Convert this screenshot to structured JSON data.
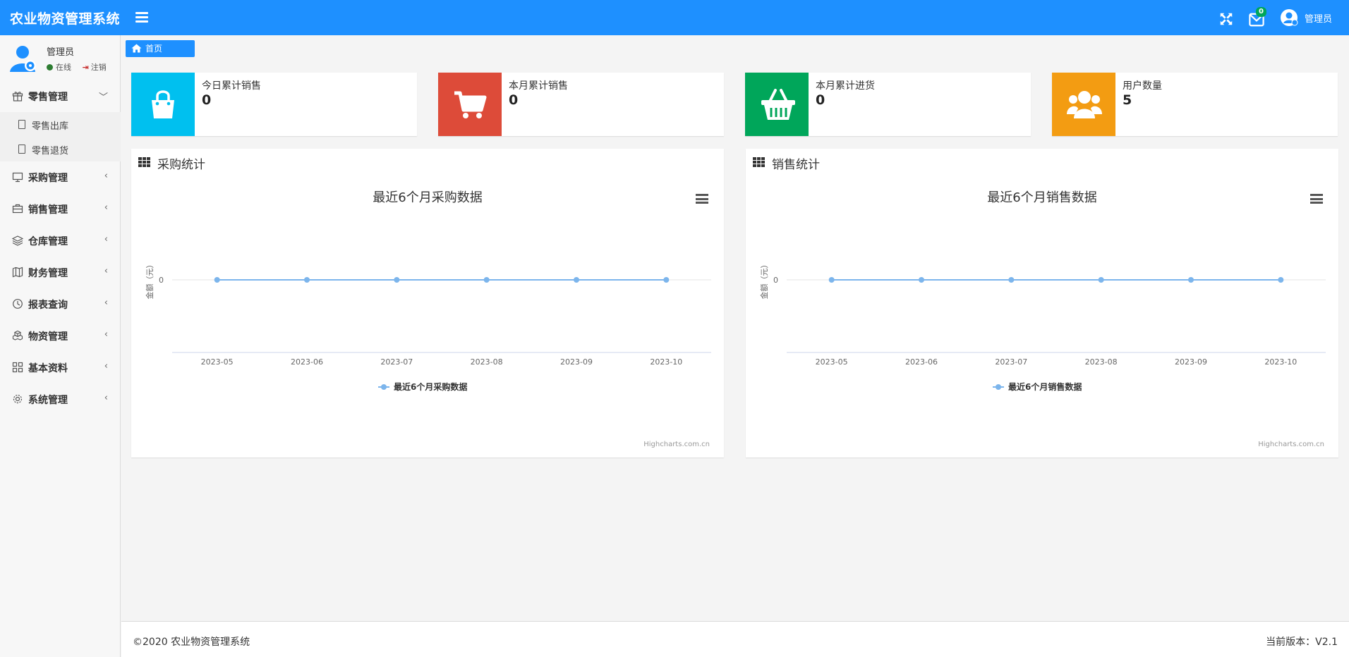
{
  "app": {
    "title": "农业物资管理系统"
  },
  "topbar": {
    "mail_badge": "0",
    "user_name": "管理员",
    "icons": [
      "menu-icon",
      "fullscreen-icon",
      "mail-icon",
      "user-avatar-icon"
    ]
  },
  "sidebar": {
    "user": {
      "name": "管理员",
      "status": "在线",
      "logout": "注销"
    },
    "items": [
      {
        "label": "零售管理",
        "icon": "gift-icon",
        "expanded": true,
        "children": [
          {
            "label": "零售出库"
          },
          {
            "label": "零售退货"
          }
        ]
      },
      {
        "label": "采购管理",
        "icon": "monitor-icon"
      },
      {
        "label": "销售管理",
        "icon": "briefcase-icon"
      },
      {
        "label": "仓库管理",
        "icon": "layers-icon"
      },
      {
        "label": "财务管理",
        "icon": "map-icon"
      },
      {
        "label": "报表查询",
        "icon": "history-icon"
      },
      {
        "label": "物资管理",
        "icon": "cubes-icon"
      },
      {
        "label": "基本资料",
        "icon": "grid-icon"
      },
      {
        "label": "系统管理",
        "icon": "gear-icon"
      }
    ]
  },
  "breadcrumb": {
    "home": "首页"
  },
  "info_boxes": [
    {
      "label": "今日累计销售",
      "value": "0",
      "color": "#00c0ef",
      "icon": "shopping-bag-icon"
    },
    {
      "label": "本月累计销售",
      "value": "0",
      "color": "#dd4b39",
      "icon": "cart-icon"
    },
    {
      "label": "本月累计进货",
      "value": "0",
      "color": "#00a65a",
      "icon": "basket-icon"
    },
    {
      "label": "用户数量",
      "value": "5",
      "color": "#f39c12",
      "icon": "users-icon"
    }
  ],
  "panels": [
    {
      "header": "采购统计"
    },
    {
      "header": "销售统计"
    }
  ],
  "chart_data": [
    {
      "type": "line",
      "title": "最近6个月采购数据",
      "ylabel": "金额（元）",
      "categories": [
        "2023-05",
        "2023-06",
        "2023-07",
        "2023-08",
        "2023-09",
        "2023-10"
      ],
      "series": [
        {
          "name": "最近6个月采购数据",
          "values": [
            0,
            0,
            0,
            0,
            0,
            0
          ]
        }
      ],
      "yticks": [
        "0"
      ],
      "legend": "bottom-center",
      "credits": "Highcharts.com.cn",
      "color": "#7cb5ec"
    },
    {
      "type": "line",
      "title": "最近6个月销售数据",
      "ylabel": "金额（元）",
      "categories": [
        "2023-05",
        "2023-06",
        "2023-07",
        "2023-08",
        "2023-09",
        "2023-10"
      ],
      "series": [
        {
          "name": "最近6个月销售数据",
          "values": [
            0,
            0,
            0,
            0,
            0,
            0
          ]
        }
      ],
      "yticks": [
        "0"
      ],
      "legend": "bottom-center",
      "credits": "Highcharts.com.cn",
      "color": "#7cb5ec"
    }
  ],
  "footer": {
    "copyright": "©2020 农业物资管理系统",
    "version": "当前版本：V2.1"
  }
}
